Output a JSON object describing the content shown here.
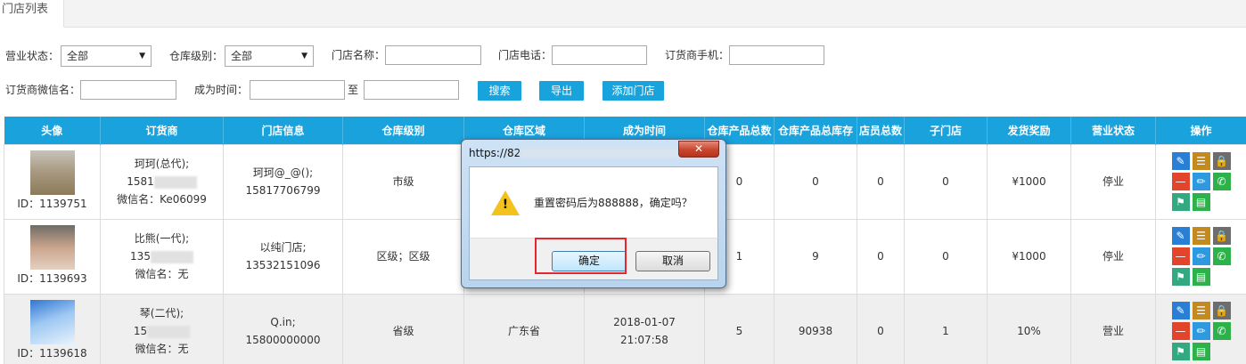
{
  "tabs": {
    "active": "门店列表"
  },
  "filters": {
    "status_label": "营业状态：",
    "status_value": "全部",
    "level_label": "仓库级别：",
    "level_value": "全部",
    "store_name_label": "门店名称：",
    "store_phone_label": "门店电话：",
    "buyer_mobile_label": "订货商手机：",
    "buyer_wechat_label": "订货商微信名：",
    "since_label": "成为时间：",
    "to_label": "至",
    "search_btn": "搜索",
    "export_btn": "导出",
    "add_btn": "添加门店"
  },
  "table": {
    "headers": [
      "头像",
      "订货商",
      "门店信息",
      "仓库级别",
      "仓库区域",
      "成为时间",
      "仓库产品总数",
      "仓库产品总库存",
      "店员总数",
      "子门店",
      "发货奖励",
      "营业状态",
      "操作"
    ],
    "rows": [
      {
        "id": "ID：1139751",
        "buyer_name": "珂珂(总代);",
        "buyer_phone": "1581",
        "buyer_wechat": "微信名：Ke06099",
        "store_name": "珂珂@_@();",
        "store_phone": "15817706799",
        "level": "市级",
        "area": "",
        "since_date": "",
        "since_time": "",
        "product_count": "0",
        "stock": "0",
        "staff": "0",
        "sub_store": "0",
        "reward": "¥1000",
        "status": "停业"
      },
      {
        "id": "ID：1139693",
        "buyer_name": "比熊(一代);",
        "buyer_phone": "135",
        "buyer_wechat": "微信名：无",
        "store_name": "以纯门店;",
        "store_phone": "13532151096",
        "level": "区级；区级",
        "area": "",
        "since_date": "",
        "since_time": "",
        "product_count": "1",
        "stock": "9",
        "staff": "0",
        "sub_store": "0",
        "reward": "¥1000",
        "status": "停业"
      },
      {
        "id": "ID：1139618",
        "buyer_name": "琴(二代);",
        "buyer_phone": "15",
        "buyer_wechat": "微信名：无",
        "store_name": "Q.in;",
        "store_phone": "15800000000",
        "level": "省级",
        "area": "广东省",
        "since_date": "2018-01-07",
        "since_time": "21:07:58",
        "product_count": "5",
        "stock": "90938",
        "staff": "0",
        "sub_store": "1",
        "reward": "10%",
        "status": "营业"
      }
    ],
    "op_icons": [
      "edit-icon",
      "list-icon",
      "lock-icon",
      "minus-icon",
      "pencil-icon",
      "phone-icon",
      "flag-icon",
      "document-icon"
    ]
  },
  "dialog": {
    "title": "https://82",
    "close": "✕",
    "message": "重置密码后为888888，确定吗？",
    "ok": "确定",
    "cancel": "取消"
  }
}
